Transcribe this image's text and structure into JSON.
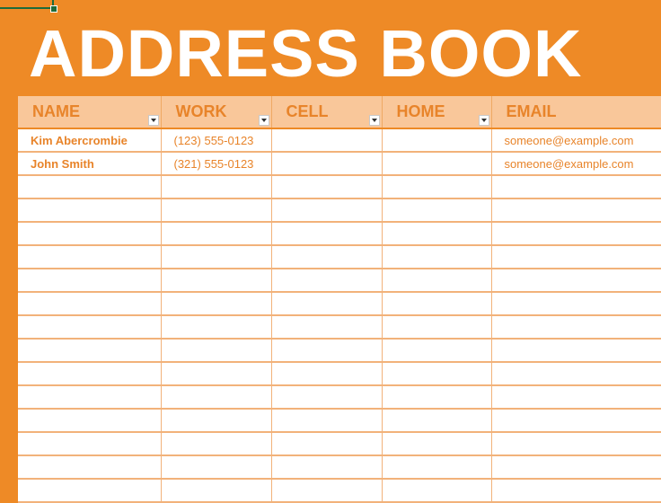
{
  "title": "ADDRESS BOOK",
  "colors": {
    "background": "#EE8A26",
    "header_fill": "#F9C79A",
    "accent_text": "#E8842A",
    "grid_line": "#F2B27A"
  },
  "table": {
    "columns": [
      {
        "label": "NAME",
        "has_filter": true
      },
      {
        "label": "WORK",
        "has_filter": true
      },
      {
        "label": "CELL",
        "has_filter": true
      },
      {
        "label": "HOME",
        "has_filter": true
      },
      {
        "label": "EMAIL",
        "has_filter": false
      }
    ],
    "rows": [
      [
        "Kim Abercrombie",
        "(123) 555-0123",
        "",
        "",
        "someone@example.com"
      ],
      [
        "John Smith",
        "(321) 555-0123",
        "",
        "",
        "someone@example.com"
      ],
      [
        "",
        "",
        "",
        "",
        ""
      ],
      [
        "",
        "",
        "",
        "",
        ""
      ],
      [
        "",
        "",
        "",
        "",
        ""
      ],
      [
        "",
        "",
        "",
        "",
        ""
      ],
      [
        "",
        "",
        "",
        "",
        ""
      ],
      [
        "",
        "",
        "",
        "",
        ""
      ],
      [
        "",
        "",
        "",
        "",
        ""
      ],
      [
        "",
        "",
        "",
        "",
        ""
      ],
      [
        "",
        "",
        "",
        "",
        ""
      ],
      [
        "",
        "",
        "",
        "",
        ""
      ],
      [
        "",
        "",
        "",
        "",
        ""
      ],
      [
        "",
        "",
        "",
        "",
        ""
      ],
      [
        "",
        "",
        "",
        "",
        ""
      ],
      [
        "",
        "",
        "",
        "",
        ""
      ]
    ]
  }
}
